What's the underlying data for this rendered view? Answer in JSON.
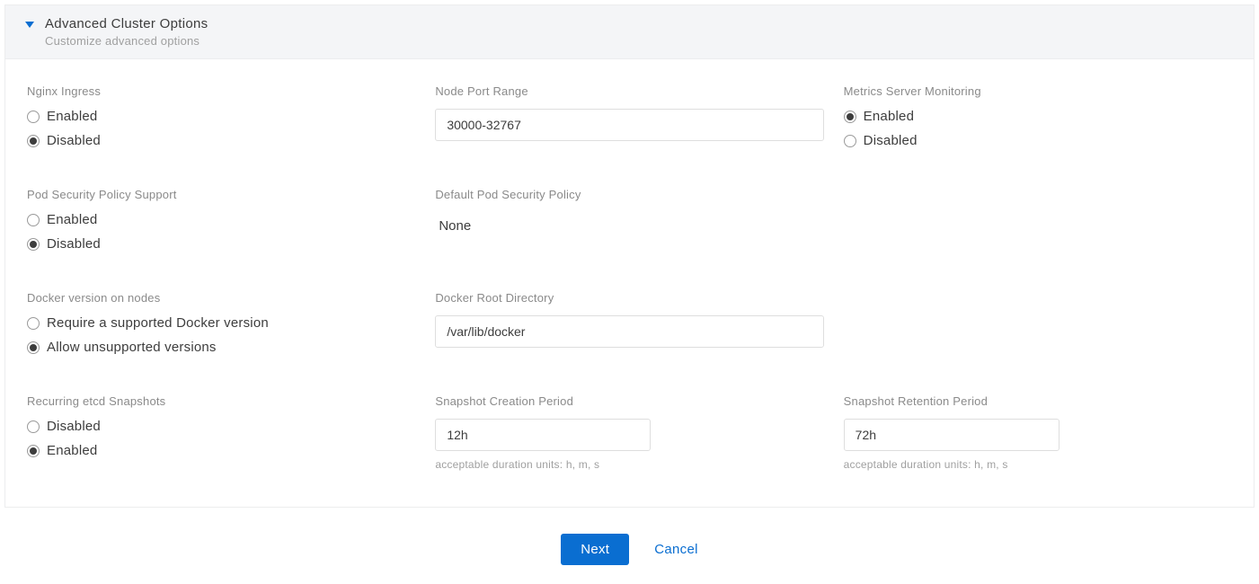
{
  "header": {
    "title": "Advanced Cluster Options",
    "subtitle": "Customize advanced options"
  },
  "nginx": {
    "label": "Nginx Ingress",
    "enabled": "Enabled",
    "disabled": "Disabled"
  },
  "nodePort": {
    "label": "Node Port Range",
    "value": "30000-32767"
  },
  "metrics": {
    "label": "Metrics Server Monitoring",
    "enabled": "Enabled",
    "disabled": "Disabled"
  },
  "podSecurity": {
    "label": "Pod Security Policy Support",
    "enabled": "Enabled",
    "disabled": "Disabled"
  },
  "defaultPodPolicy": {
    "label": "Default Pod Security Policy",
    "value": "None"
  },
  "dockerVersion": {
    "label": "Docker version on nodes",
    "require": "Require a supported Docker version",
    "allow": "Allow unsupported versions"
  },
  "dockerRoot": {
    "label": "Docker Root Directory",
    "value": "/var/lib/docker"
  },
  "etcd": {
    "label": "Recurring etcd Snapshots",
    "disabled": "Disabled",
    "enabled": "Enabled"
  },
  "snapCreation": {
    "label": "Snapshot Creation Period",
    "value": "12h",
    "hint": "acceptable duration units: h, m, s"
  },
  "snapRetention": {
    "label": "Snapshot Retention Period",
    "value": "72h",
    "hint": "acceptable duration units: h, m, s"
  },
  "actions": {
    "next": "Next",
    "cancel": "Cancel"
  }
}
